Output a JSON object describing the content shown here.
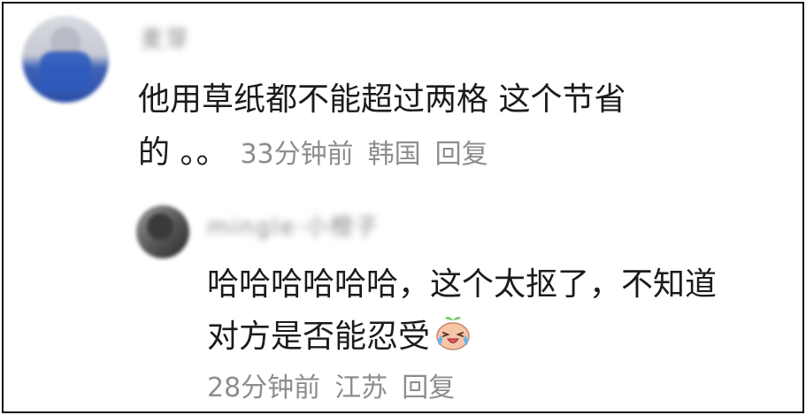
{
  "comment": {
    "username": "麦芽",
    "text_line1": "他用草纸都不能超过两格 这个节省",
    "text_line2": "的 。。",
    "time": "33分钟前",
    "location": "韩国",
    "reply_label": "回复"
  },
  "reply": {
    "username": "mingle·小橙子",
    "text_line1": "哈哈哈哈哈哈，这个太抠了，不知道",
    "text_line2": "对方是否能忍受",
    "emoji": "crying-laughing-icon",
    "time": "28分钟前",
    "location": "江苏",
    "reply_label": "回复"
  }
}
